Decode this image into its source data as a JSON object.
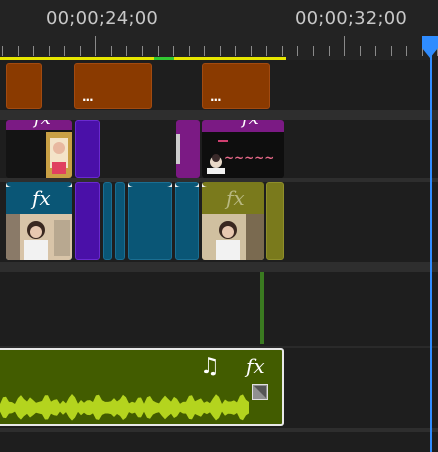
{
  "ruler": {
    "timecode_left": "00;00;24;00",
    "timecode_right": "00;00;32;00"
  },
  "clips": {
    "orange_dots": "...",
    "fx_label": "fx"
  },
  "audio": {
    "music_icon": "music-note-icon",
    "fx_label": "fx"
  },
  "colors": {
    "playhead": "#2f8cff",
    "work_area": "#e6e600",
    "orange_clip": "#8a3a00",
    "purple_clip": "#7b1a84",
    "teal_clip": "#0a5676",
    "olive_clip": "#7a7a1c",
    "audio_clip": "#425c00",
    "waveform": "#b4d41e"
  }
}
